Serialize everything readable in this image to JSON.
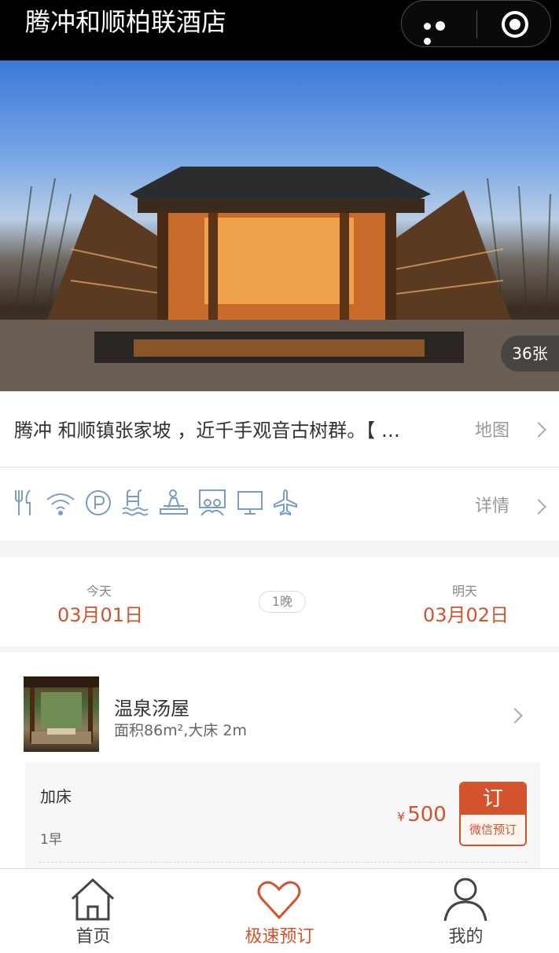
{
  "header": {
    "title": "腾冲和顺柏联酒店"
  },
  "hero": {
    "photo_count": "36张"
  },
  "location": {
    "address": "腾冲 和顺镇张家坡 ，近千手观音古树群。【 …",
    "map_label": "地图"
  },
  "facilities": {
    "icons": [
      "restaurant-icon",
      "wifi-icon",
      "parking-icon",
      "pool-icon",
      "spa-icon",
      "meeting-room-icon",
      "tv-icon",
      "airport-shuttle-icon"
    ],
    "details_label": "详情"
  },
  "dates": {
    "checkin_label": "今天",
    "checkin_date": "03月01日",
    "nights": "1晚",
    "checkout_label": "明天",
    "checkout_date": "03月02日"
  },
  "room": {
    "name": "温泉汤屋",
    "desc": "面积86m²,大床 2m",
    "rate": {
      "title": "加床",
      "meal": "1早",
      "currency": "¥",
      "price": "500",
      "book_top": "订",
      "book_bottom": "微信预订"
    }
  },
  "tabbar": {
    "items": [
      {
        "label": "首页",
        "icon": "home-icon"
      },
      {
        "label": "极速预订",
        "icon": "heart-icon"
      },
      {
        "label": "我的",
        "icon": "user-icon"
      }
    ]
  },
  "colors": {
    "accent": "#d2532c",
    "icon_blue": "#7a9cc6"
  }
}
